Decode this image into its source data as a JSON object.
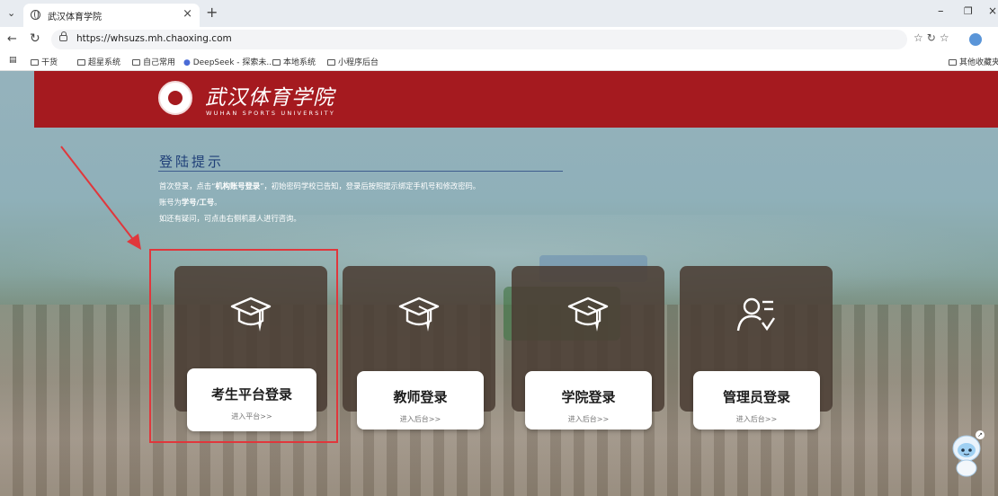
{
  "browser": {
    "tab_title": "武汉体育学院",
    "url": "https://whsuzs.mh.chaoxing.com",
    "bookmarks": [
      "干货",
      "超星系统",
      "自己常用",
      "DeepSeek - 探索未...",
      "本地系统",
      "小程序后台"
    ],
    "other_bookmarks": "其他收藏夹"
  },
  "header": {
    "school_name": "武汉体育学院",
    "school_name_en": "WUHAN SPORTS UNIVERSITY",
    "brand_color": "#a51a1f"
  },
  "notice": {
    "title": "登陆提示",
    "line1_prefix": "首次登录，点击“",
    "line1_bold": "机构账号登录",
    "line1_suffix": "”，初始密码学校已告知，登录后按照提示绑定手机号和修改密码。",
    "line2_prefix": "账号为",
    "line2_bold": "学号/工号",
    "line2_suffix": "。",
    "line3": "如还有疑问，可点击右侧机器人进行咨询。"
  },
  "cards": [
    {
      "title": "考生平台登录",
      "subtitle": "进入平台>>",
      "icon": "graduation-cap-icon"
    },
    {
      "title": "教师登录",
      "subtitle": "进入后台>>",
      "icon": "graduation-cap-icon"
    },
    {
      "title": "学院登录",
      "subtitle": "进入后台>>",
      "icon": "graduation-cap-icon"
    },
    {
      "title": "管理员登录",
      "subtitle": "进入后台>>",
      "icon": "user-list-icon"
    }
  ],
  "annotation": {
    "color": "#e0373c",
    "highlighted_card": "考生平台登录"
  }
}
